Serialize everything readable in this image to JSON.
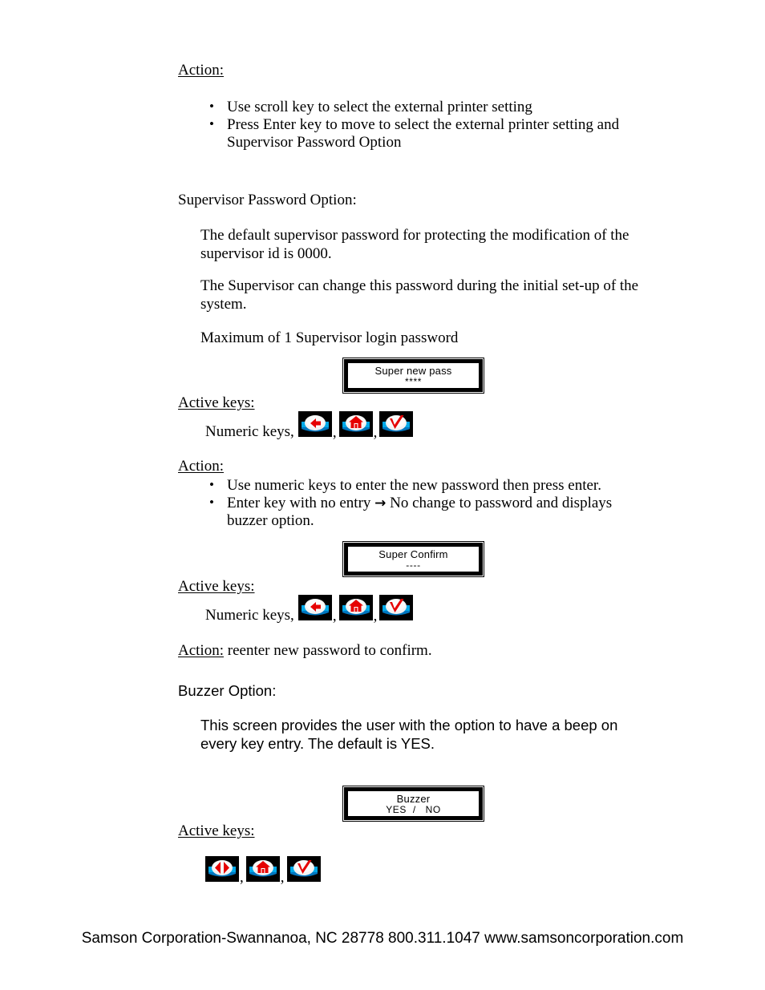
{
  "document": {
    "sections": {
      "action1": {
        "heading": "Action:",
        "bullets": [
          "Use scroll key to select the external printer setting",
          "Press Enter key to move to select the external printer setting and Supervisor Password Option"
        ]
      },
      "supervisor": {
        "heading": "Supervisor Password Option:",
        "para1": "The default supervisor password for protecting the modification of the supervisor id is 0000.",
        "para2": "The Supervisor can change this password during the initial set-up of the system.",
        "para3": "Maximum of 1 Supervisor login password"
      },
      "action2": {
        "heading": "Action:",
        "bullet1": "Use numeric keys to enter the new password then press enter.",
        "bullet2_pre": "Enter key with no entry ",
        "bullet2_arrow": "→",
        "bullet2_post": " No change to password and displays buzzer option."
      },
      "action3": {
        "heading": "Action:",
        "text": " reenter new password to confirm."
      },
      "buzzer": {
        "heading": "Buzzer Option:",
        "para": "This screen provides the user with the option to have a beep on every key entry.  The default is YES."
      }
    },
    "active_keys_labels": {
      "label1": "Active keys:",
      "label2": "Active keys:",
      "label3": "Active keys:"
    },
    "numeric_keys_label": "Numeric keys,",
    "separator": ",",
    "lcd_screens": {
      "super_new_pass": {
        "line1": "Super new pass",
        "line2": "****"
      },
      "super_confirm": {
        "line1": "Super Confirm",
        "line2": "----"
      },
      "buzzer": {
        "line1": "Buzzer",
        "line2": "YES  /   NO"
      }
    },
    "key_icons": {
      "back_arrow": "back-arrow-key-icon",
      "home": "home-key-icon",
      "enter_check": "enter-check-key-icon",
      "left_right_arrow": "left-right-arrow-key-icon"
    },
    "colors": {
      "key_background": "#000000",
      "key_band": "#00a8e8",
      "key_band_dark": "#0077c0",
      "key_oval": "#f0f0f0",
      "key_glyph_red": "#e60000"
    },
    "footer": "Samson Corporation-Swannanoa, NC 28778  800.311.1047 www.samsoncorporation.com"
  }
}
